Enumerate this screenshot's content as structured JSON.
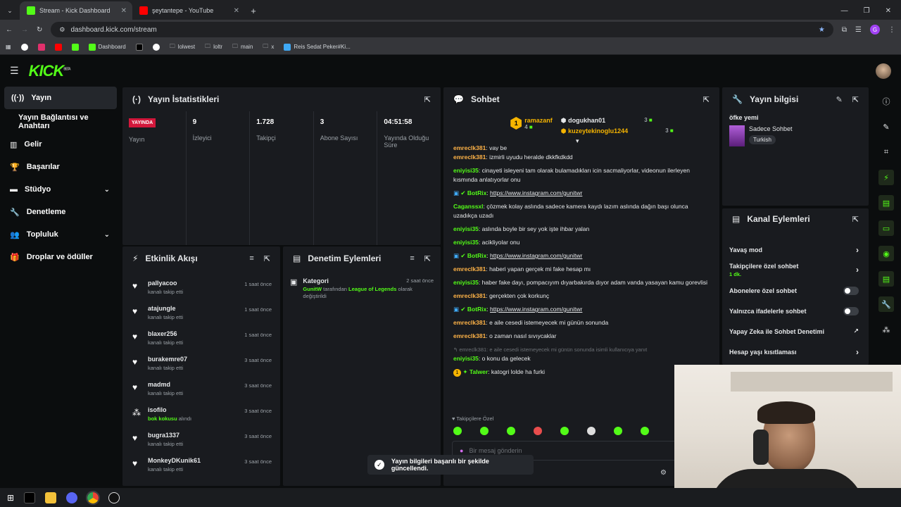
{
  "browser": {
    "tabs": [
      {
        "title": "Stream - Kick Dashboard",
        "active": true
      },
      {
        "title": "şeytantepe - YouTube",
        "active": false
      }
    ],
    "url": "dashboard.kick.com/stream",
    "bookmarks": [
      "Dashboard",
      "lolwest",
      "loltr",
      "main",
      "x",
      "Reis Sedat Peker#Ki..."
    ]
  },
  "brand": {
    "logo": "KICK",
    "beta": "BETA",
    "accent": "#53fc18"
  },
  "sidebar": {
    "items": [
      {
        "label": "Yayın",
        "active": true,
        "icon": "broadcast-icon"
      },
      {
        "label": "Yayın Bağlantısı ve Anahtarı"
      },
      {
        "label": "Gelir",
        "icon": "chart-icon"
      },
      {
        "label": "Başarılar",
        "icon": "trophy-icon"
      },
      {
        "label": "Stüdyo",
        "icon": "studio-icon",
        "expandable": true
      },
      {
        "label": "Denetleme",
        "icon": "wrench-icon"
      },
      {
        "label": "Topluluk",
        "icon": "community-icon",
        "expandable": true
      },
      {
        "label": "Droplar ve ödüller",
        "icon": "gift-icon"
      }
    ]
  },
  "stats": {
    "title": "Yayın İstatistikleri",
    "live_badge": "YAYINDA",
    "live_label": "Yayın",
    "cells": [
      {
        "value": "9",
        "label": "İzleyici"
      },
      {
        "value": "1.728",
        "label": "Takipçi"
      },
      {
        "value": "3",
        "label": "Abone Sayısı"
      },
      {
        "value": "04:51:58",
        "label": "Yayında Olduğu Süre"
      }
    ]
  },
  "activity": {
    "title": "Etkinlik Akışı",
    "items": [
      {
        "name": "pallyacoo",
        "sub": "kanalı takip etti",
        "time": "1 saat önce"
      },
      {
        "name": "atajungle",
        "sub": "kanalı takip etti",
        "time": "1 saat önce"
      },
      {
        "name": "blaxer256",
        "sub": "kanalı takip etti",
        "time": "1 saat önce"
      },
      {
        "name": "burakemre07",
        "sub": "kanalı takip etti",
        "time": "3 saat önce"
      },
      {
        "name": "madmd",
        "sub": "kanalı takip etti",
        "time": "3 saat önce"
      },
      {
        "name": "isofilo",
        "sub_hl": "bok kokusu",
        "sub": "alındı",
        "time": "3 saat önce"
      },
      {
        "name": "bugra1337",
        "sub": "kanalı takip etti",
        "time": "3 saat önce"
      },
      {
        "name": "MonkeyDKunik61",
        "sub": "kanalı takip etti",
        "time": "3 saat önce"
      }
    ]
  },
  "moderation": {
    "title": "Denetim Eylemleri",
    "item": {
      "title": "Kategori",
      "time": "2 saat önce",
      "user": "GunitW",
      "mid": "tarafından",
      "cat": "League of Legends",
      "end": "olarak değiştirildi"
    }
  },
  "chat": {
    "title": "Sohbet",
    "top": [
      {
        "rank": "1",
        "name": "ramazanf",
        "count": "4"
      },
      {
        "name": "dogukhan01",
        "count": "3"
      },
      {
        "name": "kuzeytekinoglu1244",
        "count": "3"
      }
    ],
    "messages": [
      {
        "user": "emreclk381",
        "color": "#ffb347",
        "text": "vay be"
      },
      {
        "user": "emreclk381",
        "color": "#ffb347",
        "text": "izmirli uyudu heralde dkkfkdkdd"
      },
      {
        "user": "eniyisi35",
        "color": "#53fc18",
        "text": "cinayeti isleyeni tam olarak bulamadıkları icin sacmaliyorlar, videonun ilerleyen kısmında anlatıyorlar onu"
      },
      {
        "user": "BotRix",
        "color": "#53fc18",
        "link": "https://www.instagram.com/gunitwr"
      },
      {
        "user": "Caganssxl",
        "color": "#53fc18",
        "text": "çözmek kolay aslında sadece kamera kaydı lazım aslında dağın başı olunca uzadıkça uzadı"
      },
      {
        "user": "eniyisi35",
        "color": "#53fc18",
        "text": "aslında boyle bir sey yok işte ihbar yalan"
      },
      {
        "user": "eniyisi35",
        "color": "#53fc18",
        "text": "acikliyolar onu"
      },
      {
        "user": "BotRix",
        "color": "#53fc18",
        "link": "https://www.instagram.com/gunitwr"
      },
      {
        "user": "emreclk381",
        "color": "#ffb347",
        "text": "haberi yapan gerçek mi fake hesap mı"
      },
      {
        "user": "eniyisi35",
        "color": "#53fc18",
        "text": "haber fake dayı, pompacıyım dıyarbakırda dıyor adam vanda yasayan kamu gorevlisi"
      },
      {
        "user": "emreclk381",
        "color": "#ffb347",
        "text": "gerçekten çok korkunç"
      },
      {
        "user": "BotRix",
        "color": "#53fc18",
        "link": "https://www.instagram.com/gunitwr"
      },
      {
        "user": "emreclk381",
        "color": "#ffb347",
        "text": "e aile cesedi istemeyecek mi günün sonunda"
      },
      {
        "user": "emreclk381",
        "color": "#ffb347",
        "text": "o zaman nasıl sıvıycaklar"
      }
    ],
    "reply_quote": "emreclk381: e aile cesedi istemeyecek mi günün sonunda isimli kullanıcıya yanıt",
    "reply": {
      "user": "eniyisi35",
      "text": "o konu da gelecek"
    },
    "last": {
      "rank": "1",
      "user": "Talwer",
      "text": "katogri lolde ha furki"
    },
    "followers_only": "Takipçilere Özel",
    "input_placeholder": "Bir mesaj gönderin"
  },
  "info": {
    "title": "Yayın bilgisi",
    "stream_title": "öfke yemi",
    "category": "Sadece Sohbet",
    "language": "Turkish"
  },
  "channel": {
    "title": "Kanal Eylemleri",
    "rows": [
      {
        "label": "Yavaş mod",
        "kind": "arrow"
      },
      {
        "label": "Takipçilere özel sohbet",
        "sub": "1 dk.",
        "kind": "arrow"
      },
      {
        "label": "Abonelere özel sohbet",
        "kind": "toggle"
      },
      {
        "label": "Yalnızca ifadelerle sohbet",
        "kind": "toggle"
      },
      {
        "label": "Yapay Zeka ile Sohbet Denetimi",
        "kind": "ext"
      },
      {
        "label": "Hesap yaşı kısıtlaması",
        "kind": "arrow"
      }
    ]
  },
  "toast": "Yayın bilgileri başarılı bir şekilde güncellendi."
}
